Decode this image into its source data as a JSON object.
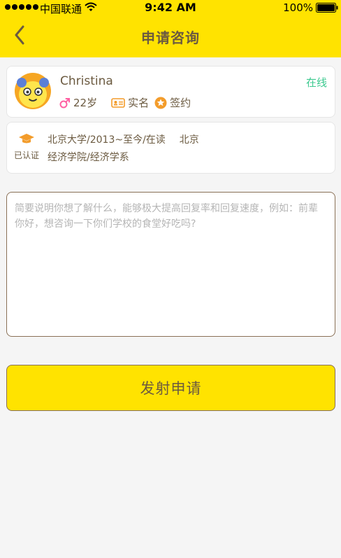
{
  "status_bar": {
    "carrier": "中国联通",
    "time": "9:42 AM",
    "battery": "100%"
  },
  "nav": {
    "title": "申请咨询",
    "back_icon": "chevron-left-icon"
  },
  "profile": {
    "name": "Christina",
    "status": "在线",
    "age": "22岁",
    "realname_label": "实名",
    "signed_label": "签约",
    "gender_icon": "male-icon",
    "status_color": "#3cc98f"
  },
  "education": {
    "badge_label": "已认证",
    "school_line": "北京大学/2013~至今/在读",
    "city": "北京",
    "department": "经济学院/经济学系"
  },
  "message": {
    "placeholder": "简要说明你想了解什么，能够极大提高回复率和回复速度，例如：前辈你好，想咨询一下你们学校的食堂好吃吗?",
    "value": ""
  },
  "submit": {
    "label": "发射申请"
  },
  "colors": {
    "brand_yellow": "#ffe300",
    "text_brown": "#6b5a40",
    "accent_orange": "#f39c2b",
    "male_pink": "#ff5fa2"
  }
}
